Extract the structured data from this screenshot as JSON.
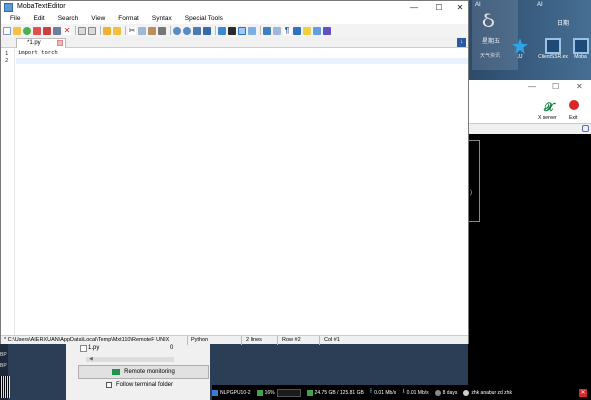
{
  "editor": {
    "title": "MobaTextEditor",
    "menu": [
      "File",
      "Edit",
      "Search",
      "View",
      "Format",
      "Syntax",
      "Special Tools"
    ],
    "tab_label": "*1.py",
    "lines": [
      {
        "num": "1",
        "text": "import torch"
      },
      {
        "num": "2",
        "text": ""
      }
    ],
    "status": {
      "path": "* C:\\Users\\AIERXUAN\\AppData\\Local\\Temp\\Mxt110\\RemoteF UNIX",
      "language": "Python",
      "line_count": "2 lines",
      "row": "Row #2",
      "col": "Col #1"
    }
  },
  "desktop": {
    "widget_ai": "AI",
    "widget_day": "星期五",
    "widget_sub": "天气资讯",
    "ai_label": "AI",
    "date_label": "日期",
    "icons": [
      {
        "label": "JJ",
        "icon": "star-icon"
      },
      {
        "label": "ClientSSR.ex",
        "icon": "computer-icon"
      },
      {
        "label": "Moba",
        "icon": "computer-icon"
      }
    ],
    "left_labels": [
      "BP",
      "BP",
      "A",
      "BP"
    ]
  },
  "background_window": {
    "xserver_label": "X server",
    "exit_label": "Exit"
  },
  "sidebar": {
    "file_name": "1.py",
    "file_size": "0",
    "remote_monitoring": "Remote monitoring",
    "follow_terminal": "Follow terminal folder"
  },
  "statusbar": {
    "host": "NLPGPU10-2",
    "cpu": "16%",
    "disk": "24.75 GB / 125.81 GB",
    "upload": "0.01 Mb/s",
    "download": "0.01 Mb/s",
    "uptime": "8 days",
    "user": "zhk  anabur  zd  zhk"
  },
  "colors": {
    "accent": "#2c5aa0",
    "current_line": "#e8f2fe"
  }
}
